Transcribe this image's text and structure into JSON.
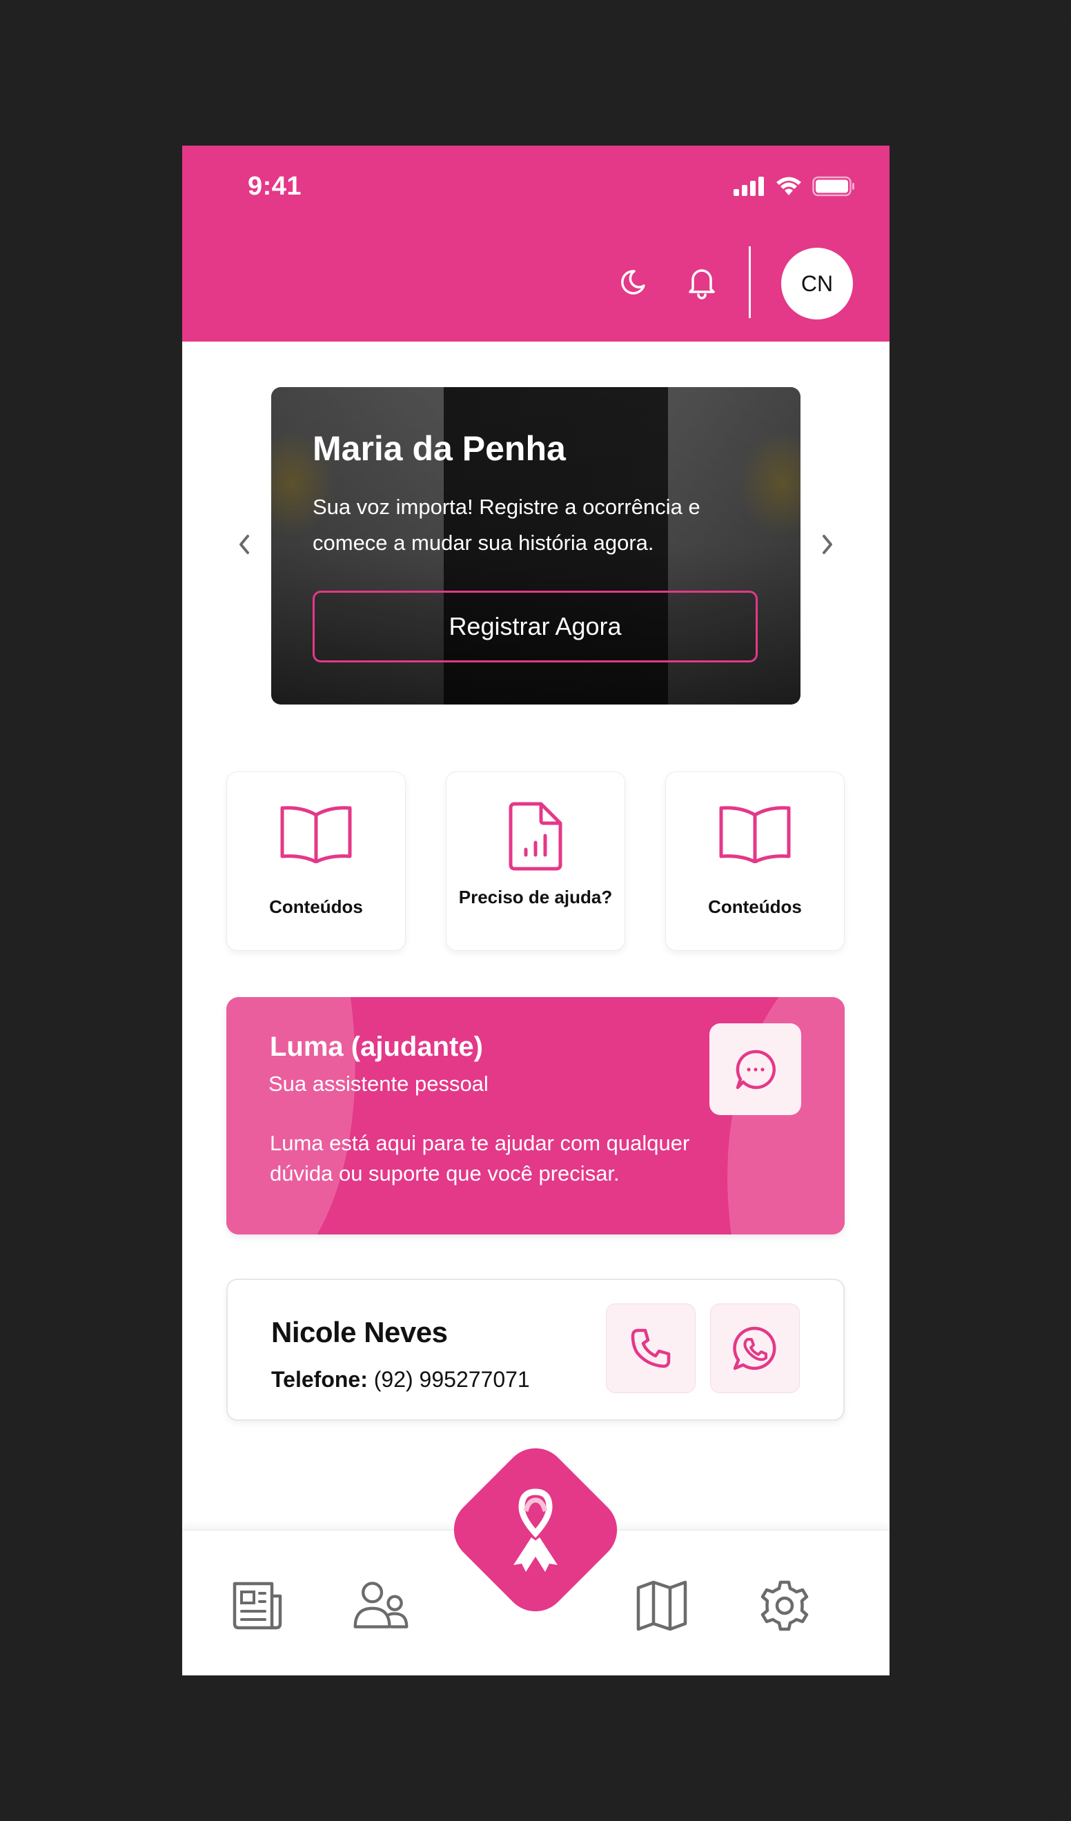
{
  "theme": {
    "accent": "#e43888",
    "accent_light": "#ea5e9e",
    "frame": "#212121",
    "icon_gray": "#6b6b6b"
  },
  "status_bar": {
    "time": "9:41",
    "icons": [
      "signal-icon",
      "wifi-icon",
      "battery-icon"
    ]
  },
  "header": {
    "icons": [
      "moon-icon",
      "bell-icon"
    ],
    "avatar_initials": "CN"
  },
  "banner": {
    "title": "Maria da Penha",
    "text": "Sua voz importa! Registre a ocorrência e comece a mudar sua história agora.",
    "button_label": "Registrar Agora",
    "prev_icon": "chevron-left-icon",
    "next_icon": "chevron-right-icon"
  },
  "quick_actions": [
    {
      "label": "Conteúdos",
      "icon": "book-open-icon"
    },
    {
      "label": "Preciso de ajuda?",
      "icon": "file-chart-icon"
    },
    {
      "label": "Conteúdos",
      "icon": "book-open-icon"
    }
  ],
  "assistant": {
    "title": "Luma (ajudante)",
    "subtitle": "Sua assistente pessoal",
    "description": "Luma está aqui para te ajudar com qualquer dúvida ou suporte que você precisar.",
    "icon": "chat-bubble-icon"
  },
  "contact": {
    "name": "Nicole Neves",
    "phone_label": "Telefone:",
    "phone_value": "(92) 995277071",
    "actions": [
      "phone-icon",
      "whatsapp-icon"
    ]
  },
  "bottom_nav": {
    "items": [
      "news-icon",
      "community-icon",
      "ribbon-icon",
      "map-icon",
      "settings-icon"
    ]
  }
}
